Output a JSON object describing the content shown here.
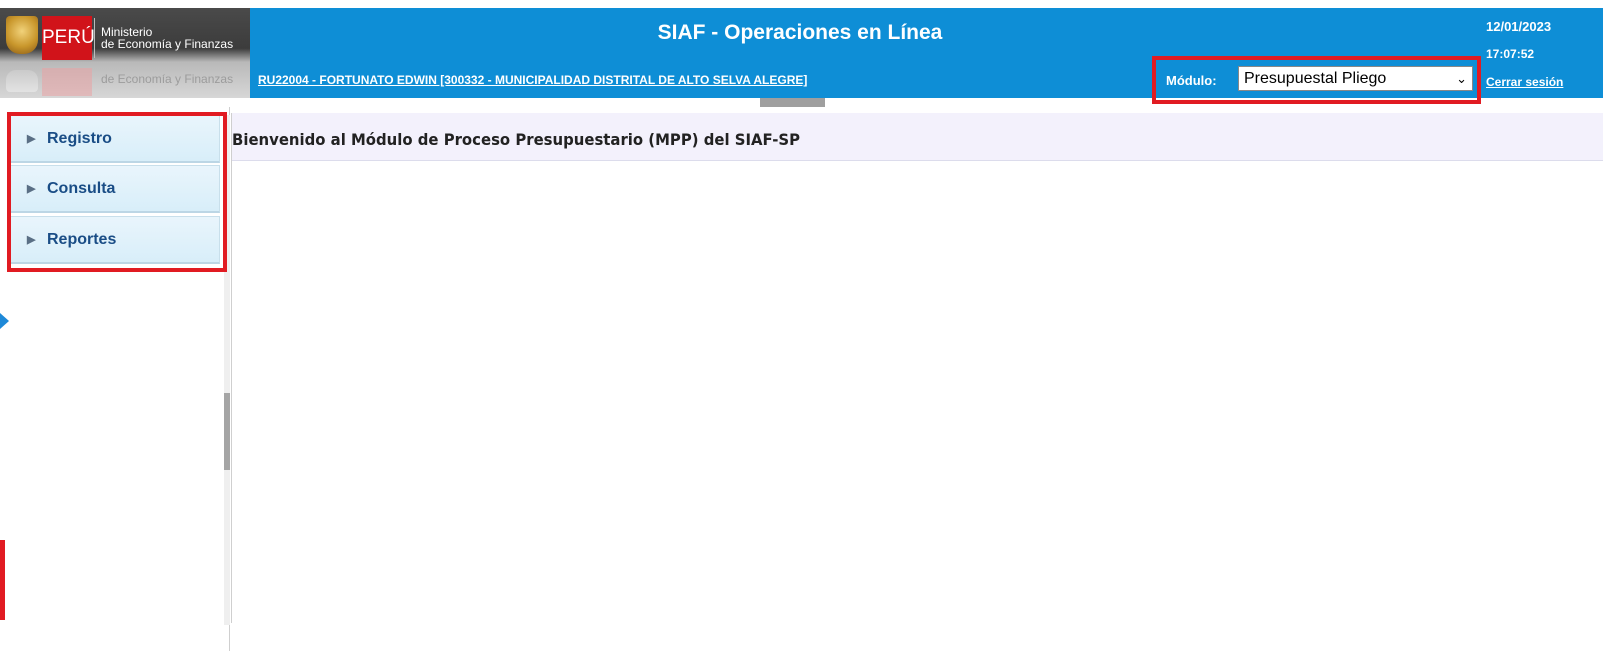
{
  "header": {
    "logo": {
      "peru": "PERÚ",
      "line1": "Ministerio",
      "line2": "de Economía y Finanzas"
    },
    "title": "SIAF - Operaciones en Línea",
    "user_info": "RU22004 - FORTUNATO EDWIN [300332 - MUNICIPALIDAD DISTRITAL DE ALTO SELVA ALEGRE]",
    "date": "12/01/2023",
    "time": "17:07:52",
    "logout": "Cerrar sesión",
    "modulo_label": "Módulo:",
    "modulo_value": "Presupuestal Pliego"
  },
  "sidebar": {
    "items": [
      {
        "label": "Registro"
      },
      {
        "label": "Consulta"
      },
      {
        "label": "Reportes"
      }
    ]
  },
  "main": {
    "welcome": "Bienvenido al Módulo de Proceso Presupuestario (MPP) del SIAF-SP"
  },
  "colors": {
    "header_bg": "#0e8ed6",
    "highlight": "#e11b22",
    "menu_text": "#1a4d86",
    "peru_red": "#d1131a"
  }
}
